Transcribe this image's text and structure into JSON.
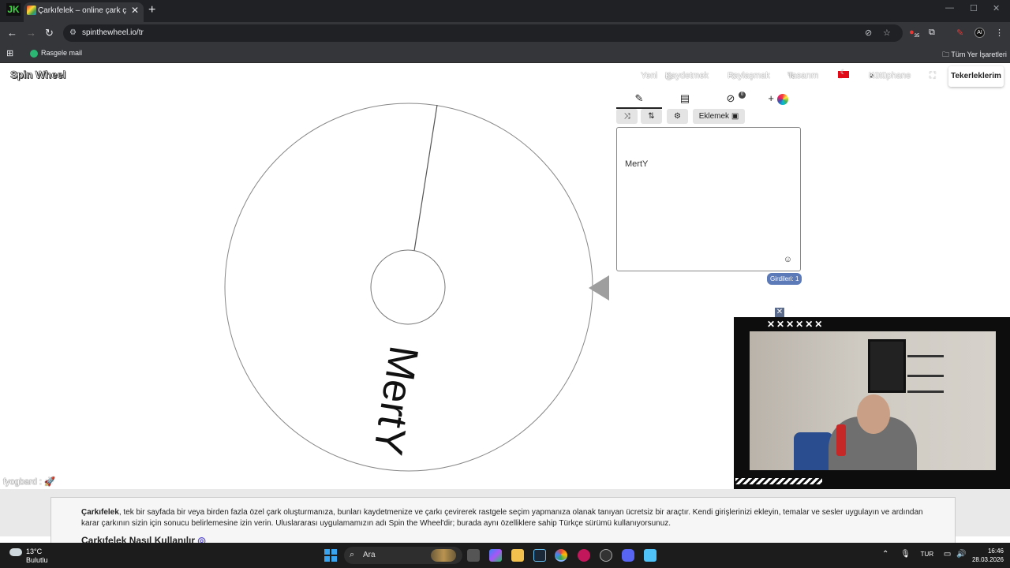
{
  "browser": {
    "tab_title": "Çarkıfelek – online çark çevirme",
    "tab_close": "✕",
    "new_tab": "+",
    "ext_left": "JK",
    "url": "spinthewheel.io/tr",
    "bookmarks": [
      {
        "label": "Rasgele mail"
      },
      {
        "label": "Tüm Yer İşaretleri"
      }
    ],
    "ext_badge": "35"
  },
  "site": {
    "logo": "Spin Wheel",
    "nav": {
      "new": "Yeni",
      "save": "Kaydetmek",
      "share": "Paylaşmak",
      "design": "Tasarım",
      "lang": "tr",
      "library": "Kütüphane",
      "my_wheels": "Tekerleklerim"
    },
    "wheel": {
      "segments": [
        "MertY"
      ]
    },
    "panel": {
      "add_button": "Eklemek",
      "entries_text": "MertY",
      "entry_count": "Girdileri: 1",
      "results_badge": "0",
      "plus": "+"
    },
    "info": {
      "brand": "Çarkıfelek",
      "text": ", tek bir sayfada bir veya birden fazla özel çark oluşturmanıza, bunları kaydetmenize ve çarkı çevirerek rastgele seçim yapmanıza olanak tanıyan ücretsiz bir araçtır. Kendi girişlerinizi ekleyin, temalar ve sesler uygulayın ve ardından karar çarkının sizin için sonucu belirlemesine izin verin. Uluslararası uygulamamızın adı Spin the Wheel'dir; burada aynı özelliklere sahip Türkçe sürümü kullanıyorsunuz.",
      "heading": "Çarkıfelek Nasıl Kullanılır"
    },
    "overlay_user": "fyogbard :"
  },
  "webcam": {
    "close": "✕",
    "x_marks": "✕✕✕✕✕✕"
  },
  "taskbar": {
    "temp": "13°C",
    "condition": "Bulutlu",
    "search_placeholder": "Ara",
    "lang": "TUR",
    "time": "16:46",
    "date": "28.03.2026"
  }
}
